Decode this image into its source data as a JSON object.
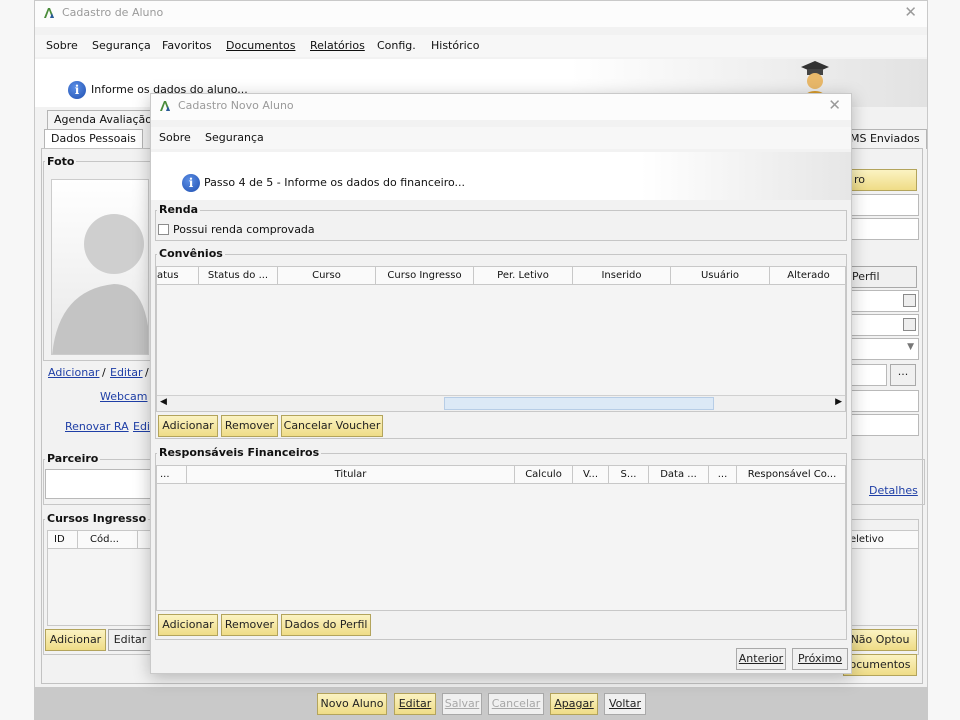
{
  "main_window": {
    "title": "Cadastro de Aluno",
    "menu": [
      "Sobre",
      "Segurança",
      "Favoritos",
      "Documentos",
      "Relatórios",
      "Config.",
      "Histórico"
    ],
    "info_text": "Informe os dados do aluno...",
    "tabs_row1": [
      "Agenda Avaliação"
    ],
    "tabs_row2": [
      "Dados Pessoais",
      "MS Enviados"
    ],
    "foto_legend": "Foto",
    "foto_links": {
      "adicionar": "Adicionar",
      "sep1": "/",
      "editar": "Editar",
      "sep2": "/"
    },
    "webcam_link": "Webcam",
    "renovar_ra_link": "Renovar RA",
    "edi_link": "Edi",
    "parceiro_legend": "Parceiro",
    "cursos_ingresso_legend": "Cursos Ingresso",
    "cursos_columns": [
      "ID",
      "Cód..."
    ],
    "cursos_buttons": {
      "adicionar": "Adicionar",
      "editar": "Editar"
    },
    "right_side": {
      "ro_button": "ro",
      "perfil_button": "Perfil",
      "detalhes_link": "Detalhes",
      "seletivo_header": "eletivo",
      "nao_optou_button": "Não Optou",
      "documentos_button": "ocumentos"
    },
    "bottom_buttons": {
      "novo_aluno": "Novo Aluno",
      "editar": "Editar",
      "salvar": "Salvar",
      "cancelar": "Cancelar",
      "apagar": "Apagar",
      "voltar": "Voltar"
    }
  },
  "dialog": {
    "title": "Cadastro Novo Aluno",
    "menu": [
      "Sobre",
      "Segurança"
    ],
    "step_text": "Passo 4 de 5 - Informe os dados do financeiro...",
    "renda_legend": "Renda",
    "renda_checkbox_label": "Possui renda comprovada",
    "convenios_legend": "Convênios",
    "convenios_columns": [
      "atus",
      "Status do ...",
      "Curso",
      "Curso Ingresso",
      "Per. Letivo",
      "Inserido",
      "Usuário",
      "Alterado"
    ],
    "convenios_buttons": {
      "adicionar": "Adicionar",
      "remover": "Remover",
      "cancelar_voucher": "Cancelar Voucher"
    },
    "responsaveis_legend": "Responsáveis Financeiros",
    "responsaveis_columns": [
      "...",
      "Titular",
      "Calculo",
      "V...",
      "S...",
      "Data ...",
      "...",
      "Responsável Co..."
    ],
    "responsaveis_buttons": {
      "adicionar": "Adicionar",
      "remover": "Remover",
      "dados_perfil": "Dados do Perfil"
    },
    "nav_buttons": {
      "anterior": "Anterior",
      "proximo": "Próximo"
    }
  },
  "colors": {
    "accent_yellow": "#efdc86",
    "link_blue": "#1f3fa6",
    "info_blue": "#1f4fb0"
  }
}
